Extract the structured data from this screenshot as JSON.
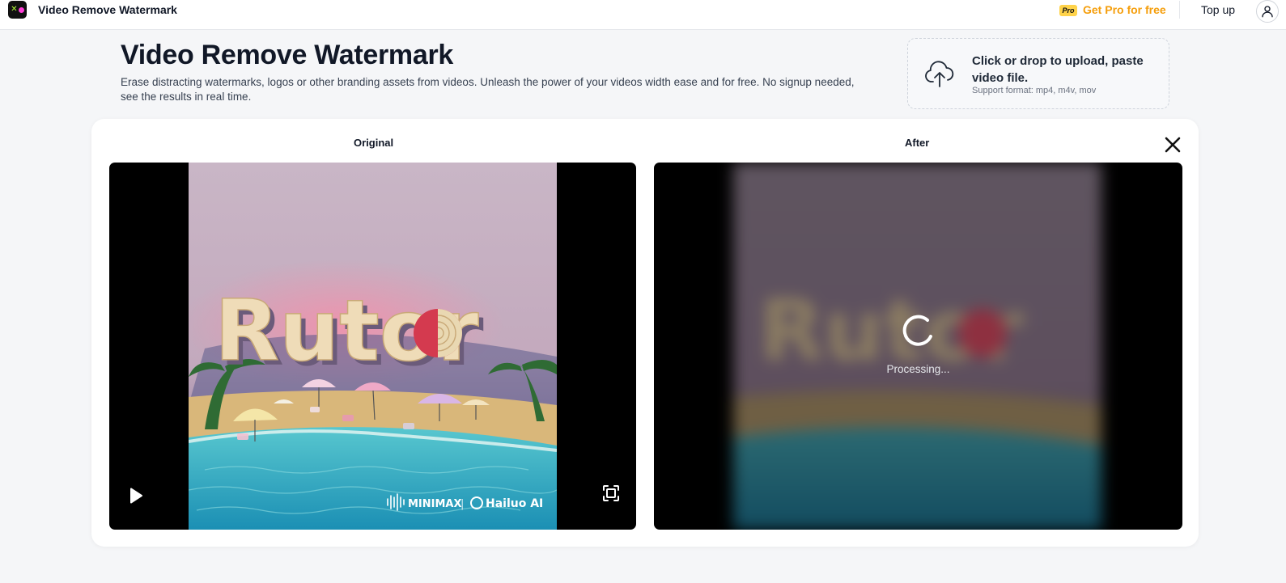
{
  "app": {
    "title": "Video Remove Watermark",
    "logo_icon": "xd-logo-icon"
  },
  "topbar": {
    "pro_badge": "Pro",
    "get_pro_label": "Get Pro for free",
    "topup_label": "Top up",
    "user_icon": "user-icon"
  },
  "header": {
    "title": "Video Remove Watermark",
    "description": "Erase distracting watermarks, logos or other branding assets from videos. Unleash the power of your videos width ease and for free. No signup needed, see the results in real time."
  },
  "upload": {
    "main_text": "Click or drop to upload, paste video file.",
    "formats_text": "Support format: mp4, m4v, mov",
    "icon": "cloud-upload-icon"
  },
  "compare": {
    "original_label": "Original",
    "after_label": "After",
    "processing_text": "Processing...",
    "video_word": "Rutor",
    "watermark_brand": "MINIMAX",
    "watermark_separator": "|",
    "watermark_product": "Hailuo AI"
  },
  "colors": {
    "accent_orange": "#f59e0b",
    "pro_badge_bg": "#ffd34a",
    "page_bg": "#f5f6f8"
  }
}
